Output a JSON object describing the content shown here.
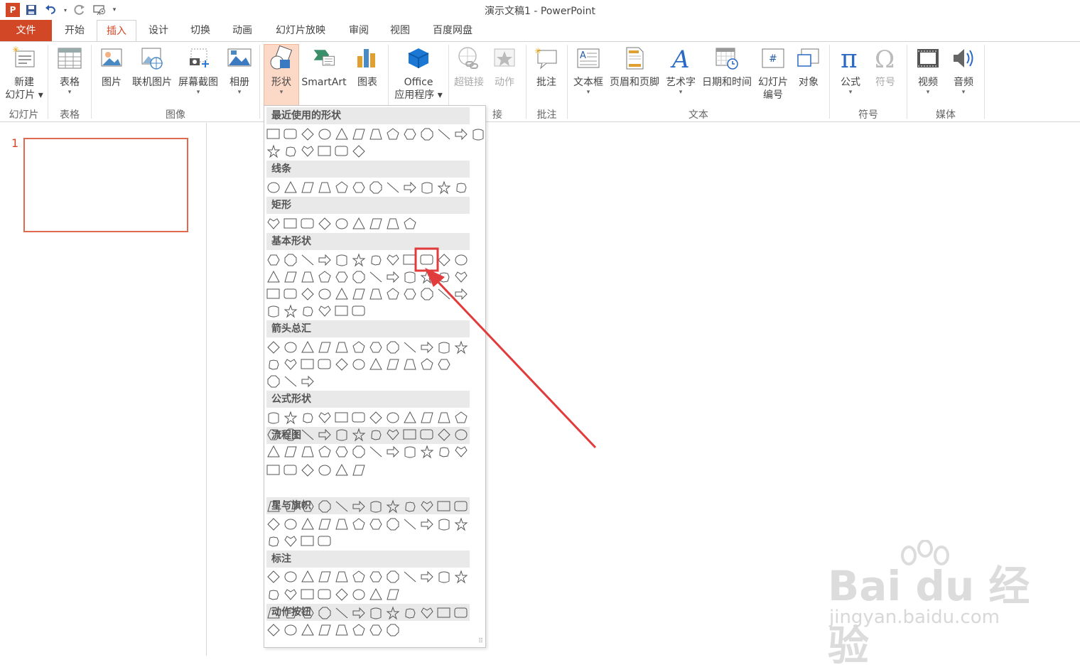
{
  "window_title": "演示文稿1 - PowerPoint",
  "qat": {
    "app_badge": "P"
  },
  "tabs": [
    "文件",
    "开始",
    "插入",
    "设计",
    "切换",
    "动画",
    "幻灯片放映",
    "审阅",
    "视图",
    "百度网盘"
  ],
  "ribbon": {
    "buttons": [
      {
        "name": "new-slide",
        "line1": "新建",
        "line2": "幻灯片 ▾"
      },
      {
        "name": "table",
        "line1": "表格"
      },
      {
        "name": "pictures",
        "line1": "图片"
      },
      {
        "name": "online-pictures",
        "line1": "联机图片"
      },
      {
        "name": "screenshot",
        "line1": "屏幕截图"
      },
      {
        "name": "album",
        "line1": "相册"
      },
      {
        "name": "shapes",
        "line1": "形状"
      },
      {
        "name": "smartart",
        "line1": "SmartArt"
      },
      {
        "name": "chart",
        "line1": "图表"
      },
      {
        "name": "office-apps",
        "line1": "Office",
        "line2": "应用程序 ▾"
      },
      {
        "name": "hyperlink",
        "line1": "超链接"
      },
      {
        "name": "action",
        "line1": "动作"
      },
      {
        "name": "comment",
        "line1": "批注"
      },
      {
        "name": "textbox",
        "line1": "文本框"
      },
      {
        "name": "header-footer",
        "line1": "页眉和页脚"
      },
      {
        "name": "wordart",
        "line1": "艺术字"
      },
      {
        "name": "date-time",
        "line1": "日期和时间"
      },
      {
        "name": "slide-number",
        "line1": "幻灯片",
        "line2": "编号"
      },
      {
        "name": "object",
        "line1": "对象"
      },
      {
        "name": "equation",
        "line1": "公式"
      },
      {
        "name": "symbol",
        "line1": "符号"
      },
      {
        "name": "video",
        "line1": "视频"
      },
      {
        "name": "audio",
        "line1": "音频"
      }
    ],
    "groups": [
      "幻灯片",
      "表格",
      "图像",
      "接",
      "批注",
      "文本",
      "符号",
      "媒体"
    ]
  },
  "slides": {
    "number": "1"
  },
  "gallery": {
    "categories": [
      "最近使用的形状",
      "线条",
      "矩形",
      "基本形状",
      "箭头总汇",
      "公式形状",
      "流程图",
      "星与旗帜",
      "标注",
      "动作按钮"
    ]
  },
  "watermark": {
    "logo": "Bai du 经验",
    "url": "jingyan.baidu.com"
  },
  "colors": {
    "accent": "#d24726",
    "highlight": "#e23b3b"
  }
}
